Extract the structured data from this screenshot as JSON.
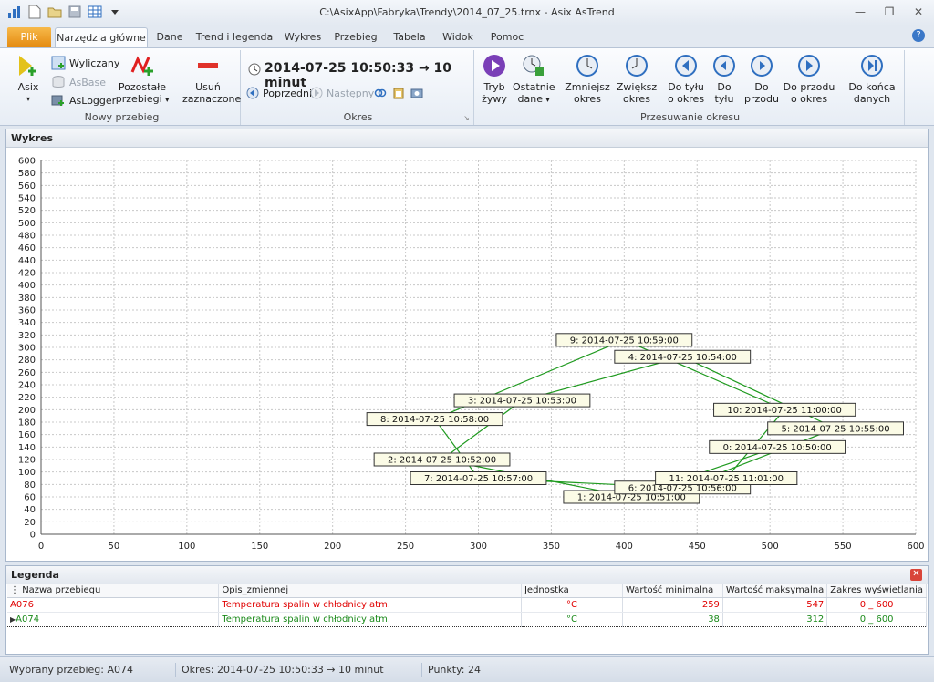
{
  "window": {
    "title": "C:\\AsixApp\\Fabryka\\Trendy\\2014_07_25.trnx - Asix AsTrend"
  },
  "tabs": {
    "plik": "Plik",
    "items": [
      "Narzędzia główne",
      "Dane",
      "Trend i legenda",
      "Wykres",
      "Przebieg",
      "Tabela",
      "Widok",
      "Pomoc"
    ]
  },
  "ribbon": {
    "nowy": {
      "asix": "Asix",
      "wyliczany": "Wyliczany",
      "asbase": "AsBase",
      "aslogger": "AsLogger",
      "pozostale_1": "Pozostałe",
      "pozostale_2": "przebiegi",
      "usun_1": "Usuń",
      "usun_2": "zaznaczone",
      "label": "Nowy przebieg"
    },
    "okres": {
      "period": "2014-07-25  10:50:33 → 10 minut",
      "poprzedni": "Poprzedni",
      "nastepny": "Następny",
      "label": "Okres"
    },
    "przesuwanie": {
      "tryb_1": "Tryb",
      "tryb_2": "żywy",
      "ostatnie_1": "Ostatnie",
      "ostatnie_2": "dane",
      "zmniejsz_1": "Zmniejsz",
      "zmniejsz_2": "okres",
      "zwieksz_1": "Zwiększ",
      "zwieksz_2": "okres",
      "dotylu_okres_1": "Do tyłu",
      "dotylu_okres_2": "o okres",
      "dotylu_1": "Do",
      "dotylu_2": "tyłu",
      "doprzodu_1": "Do",
      "doprzodu_2": "przodu",
      "doprzodu_okres_1": "Do przodu",
      "doprzodu_okres_2": "o okres",
      "dokonca_1": "Do końca",
      "dokonca_2": "danych",
      "label": "Przesuwanie okresu"
    }
  },
  "chart_panel": {
    "title": "Wykres"
  },
  "chart_data": {
    "type": "scatter",
    "xlim": [
      0,
      600
    ],
    "ylim": [
      0,
      600
    ],
    "x_ticks": [
      0,
      50,
      100,
      150,
      200,
      250,
      300,
      350,
      400,
      450,
      500,
      550,
      600
    ],
    "y_ticks": [
      0,
      20,
      40,
      60,
      80,
      100,
      120,
      140,
      160,
      180,
      200,
      220,
      240,
      260,
      280,
      300,
      320,
      340,
      360,
      380,
      400,
      420,
      440,
      460,
      480,
      500,
      520,
      540,
      560,
      580,
      600
    ],
    "grid": true,
    "line_color": "#1f9a1f",
    "points": [
      {
        "n": 0,
        "x": 505,
        "y": 140,
        "label": "0: 2014-07-25 10:50:00"
      },
      {
        "n": 1,
        "x": 405,
        "y": 60,
        "label": "1: 2014-07-25 10:51:00"
      },
      {
        "n": 2,
        "x": 275,
        "y": 120,
        "label": "2: 2014-07-25 10:52:00"
      },
      {
        "n": 3,
        "x": 330,
        "y": 215,
        "label": "3: 2014-07-25 10:53:00"
      },
      {
        "n": 4,
        "x": 440,
        "y": 285,
        "label": "4: 2014-07-25 10:54:00"
      },
      {
        "n": 5,
        "x": 545,
        "y": 170,
        "label": "5: 2014-07-25 10:55:00"
      },
      {
        "n": 6,
        "x": 440,
        "y": 75,
        "label": "6: 2014-07-25 10:56:00"
      },
      {
        "n": 7,
        "x": 300,
        "y": 90,
        "label": "7: 2014-07-25 10:57:00"
      },
      {
        "n": 8,
        "x": 270,
        "y": 185,
        "label": "8: 2014-07-25 10:58:00"
      },
      {
        "n": 9,
        "x": 400,
        "y": 312,
        "label": "9: 2014-07-25 10:59:00"
      },
      {
        "n": 10,
        "x": 510,
        "y": 200,
        "label": "10: 2014-07-25 11:00:00"
      },
      {
        "n": 11,
        "x": 470,
        "y": 90,
        "label": "11: 2014-07-25 11:01:00"
      }
    ]
  },
  "legend": {
    "title": "Legenda",
    "headers": [
      "Nazwa przebiegu",
      "Opis_zmiennej",
      "Jednostka",
      "Wartość minimalna",
      "Wartość maksymalna",
      "Zakres wyświetlania"
    ],
    "rows": [
      {
        "name": "A076",
        "desc": "Temperatura spalin w chłodnicy atm.",
        "unit": "°C",
        "min": "259",
        "max": "547",
        "range": "0 _ 600",
        "color": "#e00000"
      },
      {
        "name": "A074",
        "desc": "Temperatura spalin w chłodnicy atm.",
        "unit": "°C",
        "min": "38",
        "max": "312",
        "range": "0 _ 600",
        "color": "#1a8a1a"
      }
    ]
  },
  "status": {
    "wybrany": "Wybrany przebieg: A074",
    "okres": "Okres: 2014-07-25  10:50:33 → 10 minut",
    "punkty": "Punkty: 24"
  }
}
